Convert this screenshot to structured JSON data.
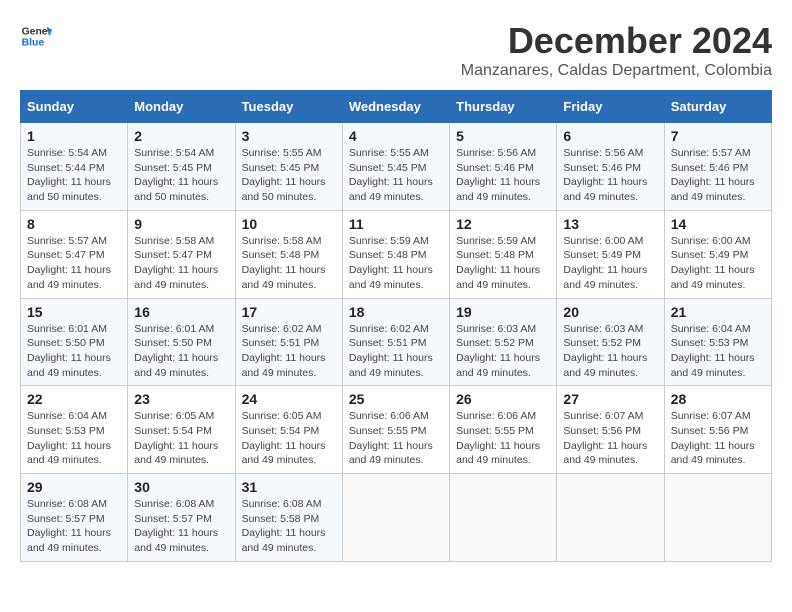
{
  "logo": {
    "line1": "General",
    "line2": "Blue"
  },
  "title": "December 2024",
  "subtitle": "Manzanares, Caldas Department, Colombia",
  "days_of_week": [
    "Sunday",
    "Monday",
    "Tuesday",
    "Wednesday",
    "Thursday",
    "Friday",
    "Saturday"
  ],
  "weeks": [
    [
      {
        "day": "1",
        "info": "Sunrise: 5:54 AM\nSunset: 5:44 PM\nDaylight: 11 hours\nand 50 minutes."
      },
      {
        "day": "2",
        "info": "Sunrise: 5:54 AM\nSunset: 5:45 PM\nDaylight: 11 hours\nand 50 minutes."
      },
      {
        "day": "3",
        "info": "Sunrise: 5:55 AM\nSunset: 5:45 PM\nDaylight: 11 hours\nand 50 minutes."
      },
      {
        "day": "4",
        "info": "Sunrise: 5:55 AM\nSunset: 5:45 PM\nDaylight: 11 hours\nand 49 minutes."
      },
      {
        "day": "5",
        "info": "Sunrise: 5:56 AM\nSunset: 5:46 PM\nDaylight: 11 hours\nand 49 minutes."
      },
      {
        "day": "6",
        "info": "Sunrise: 5:56 AM\nSunset: 5:46 PM\nDaylight: 11 hours\nand 49 minutes."
      },
      {
        "day": "7",
        "info": "Sunrise: 5:57 AM\nSunset: 5:46 PM\nDaylight: 11 hours\nand 49 minutes."
      }
    ],
    [
      {
        "day": "8",
        "info": "Sunrise: 5:57 AM\nSunset: 5:47 PM\nDaylight: 11 hours\nand 49 minutes."
      },
      {
        "day": "9",
        "info": "Sunrise: 5:58 AM\nSunset: 5:47 PM\nDaylight: 11 hours\nand 49 minutes."
      },
      {
        "day": "10",
        "info": "Sunrise: 5:58 AM\nSunset: 5:48 PM\nDaylight: 11 hours\nand 49 minutes."
      },
      {
        "day": "11",
        "info": "Sunrise: 5:59 AM\nSunset: 5:48 PM\nDaylight: 11 hours\nand 49 minutes."
      },
      {
        "day": "12",
        "info": "Sunrise: 5:59 AM\nSunset: 5:48 PM\nDaylight: 11 hours\nand 49 minutes."
      },
      {
        "day": "13",
        "info": "Sunrise: 6:00 AM\nSunset: 5:49 PM\nDaylight: 11 hours\nand 49 minutes."
      },
      {
        "day": "14",
        "info": "Sunrise: 6:00 AM\nSunset: 5:49 PM\nDaylight: 11 hours\nand 49 minutes."
      }
    ],
    [
      {
        "day": "15",
        "info": "Sunrise: 6:01 AM\nSunset: 5:50 PM\nDaylight: 11 hours\nand 49 minutes."
      },
      {
        "day": "16",
        "info": "Sunrise: 6:01 AM\nSunset: 5:50 PM\nDaylight: 11 hours\nand 49 minutes."
      },
      {
        "day": "17",
        "info": "Sunrise: 6:02 AM\nSunset: 5:51 PM\nDaylight: 11 hours\nand 49 minutes."
      },
      {
        "day": "18",
        "info": "Sunrise: 6:02 AM\nSunset: 5:51 PM\nDaylight: 11 hours\nand 49 minutes."
      },
      {
        "day": "19",
        "info": "Sunrise: 6:03 AM\nSunset: 5:52 PM\nDaylight: 11 hours\nand 49 minutes."
      },
      {
        "day": "20",
        "info": "Sunrise: 6:03 AM\nSunset: 5:52 PM\nDaylight: 11 hours\nand 49 minutes."
      },
      {
        "day": "21",
        "info": "Sunrise: 6:04 AM\nSunset: 5:53 PM\nDaylight: 11 hours\nand 49 minutes."
      }
    ],
    [
      {
        "day": "22",
        "info": "Sunrise: 6:04 AM\nSunset: 5:53 PM\nDaylight: 11 hours\nand 49 minutes."
      },
      {
        "day": "23",
        "info": "Sunrise: 6:05 AM\nSunset: 5:54 PM\nDaylight: 11 hours\nand 49 minutes."
      },
      {
        "day": "24",
        "info": "Sunrise: 6:05 AM\nSunset: 5:54 PM\nDaylight: 11 hours\nand 49 minutes."
      },
      {
        "day": "25",
        "info": "Sunrise: 6:06 AM\nSunset: 5:55 PM\nDaylight: 11 hours\nand 49 minutes."
      },
      {
        "day": "26",
        "info": "Sunrise: 6:06 AM\nSunset: 5:55 PM\nDaylight: 11 hours\nand 49 minutes."
      },
      {
        "day": "27",
        "info": "Sunrise: 6:07 AM\nSunset: 5:56 PM\nDaylight: 11 hours\nand 49 minutes."
      },
      {
        "day": "28",
        "info": "Sunrise: 6:07 AM\nSunset: 5:56 PM\nDaylight: 11 hours\nand 49 minutes."
      }
    ],
    [
      {
        "day": "29",
        "info": "Sunrise: 6:08 AM\nSunset: 5:57 PM\nDaylight: 11 hours\nand 49 minutes."
      },
      {
        "day": "30",
        "info": "Sunrise: 6:08 AM\nSunset: 5:57 PM\nDaylight: 11 hours\nand 49 minutes."
      },
      {
        "day": "31",
        "info": "Sunrise: 6:08 AM\nSunset: 5:58 PM\nDaylight: 11 hours\nand 49 minutes."
      },
      {
        "day": "",
        "info": ""
      },
      {
        "day": "",
        "info": ""
      },
      {
        "day": "",
        "info": ""
      },
      {
        "day": "",
        "info": ""
      }
    ]
  ]
}
